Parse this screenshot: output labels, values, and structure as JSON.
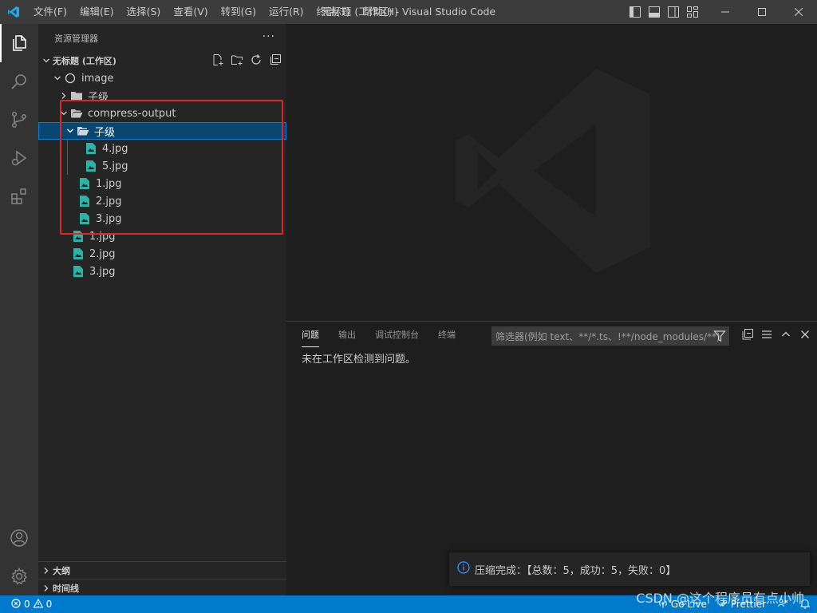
{
  "titlebar": {
    "menus": [
      "文件(F)",
      "编辑(E)",
      "选择(S)",
      "查看(V)",
      "转到(G)",
      "运行(R)",
      "终端(T)",
      "帮助(H)"
    ],
    "title": "无标题 (工作区) - Visual Studio Code"
  },
  "sidebar": {
    "title": "资源管理器",
    "workspace": "无标题 (工作区)",
    "tree": {
      "image": "image",
      "child_collapsed": "子级",
      "compress_output": "compress-output",
      "child_expanded": "子级",
      "f4": "4.jpg",
      "f5": "5.jpg",
      "f1a": "1.jpg",
      "f2a": "2.jpg",
      "f3a": "3.jpg",
      "f1b": "1.jpg",
      "f2b": "2.jpg",
      "f3b": "3.jpg"
    },
    "outline": "大纲",
    "timeline": "时间线"
  },
  "panel": {
    "tabs": [
      "问题",
      "输出",
      "调试控制台",
      "终端"
    ],
    "filter_placeholder": "筛选器(例如 text、**/*.ts、!**/node_modules/**)",
    "message": "未在工作区检测到问题。"
  },
  "notification": {
    "text": "压缩完成：【总数：5，成功：5，失败：0】"
  },
  "statusbar": {
    "errors": "0",
    "warnings": "0",
    "golive": "Go Live",
    "prettier": "Prettier"
  },
  "watermark": "CSDN @这个程序员有点小帅",
  "colors": {
    "accent": "#007acc",
    "selection": "#094771",
    "file_icon": "#2ab3a6",
    "highlight_box": "#e0262a"
  }
}
